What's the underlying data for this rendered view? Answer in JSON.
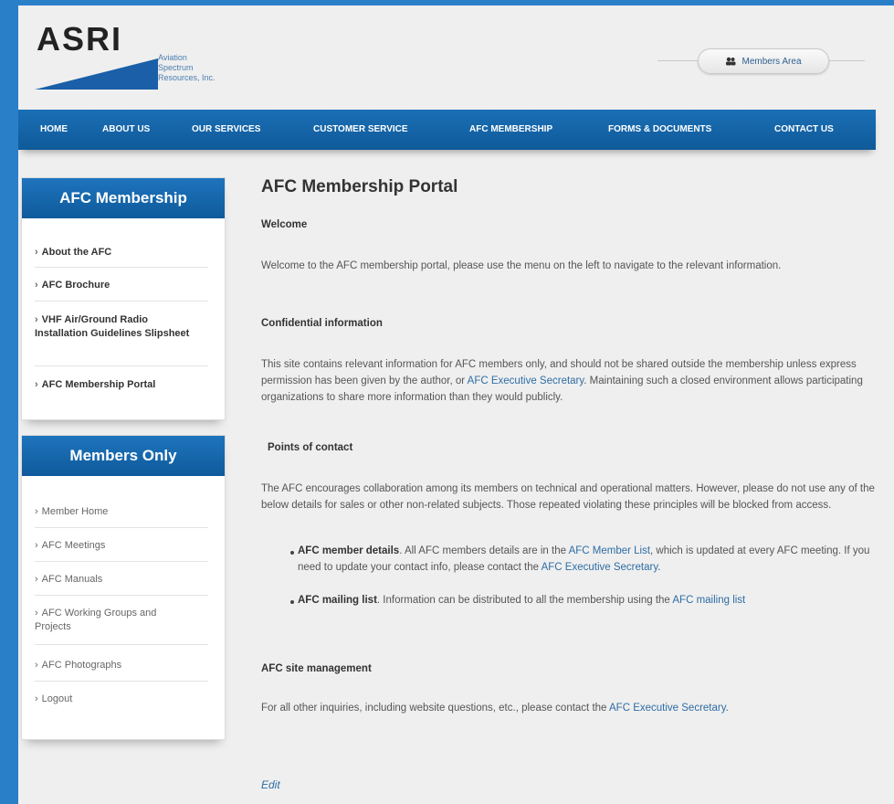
{
  "logo": {
    "name": "ASRI",
    "subtitle_lines": [
      "Aviation",
      "Spectrum",
      "Resources, Inc."
    ]
  },
  "members_area": {
    "label": "Members Area",
    "icon": "users-icon"
  },
  "nav": {
    "items": [
      "HOME",
      "ABOUT US",
      "OUR SERVICES",
      "CUSTOMER SERVICE",
      "AFC MEMBERSHIP",
      "FORMS & DOCUMENTS",
      "CONTACT US"
    ]
  },
  "sidebar": {
    "afc_title": "AFC Membership",
    "afc_items": [
      "About the AFC",
      "AFC Brochure",
      "VHF Air/Ground Radio Installation Guidelines Slipsheet",
      "AFC Membership Portal"
    ],
    "members_title": "Members Only",
    "members_items": [
      "Member Home",
      "AFC Meetings",
      "AFC Manuals",
      "AFC Working Groups and Projects",
      "AFC Photographs",
      "Logout"
    ]
  },
  "main": {
    "title": "AFC Membership Portal",
    "welcome_heading": "Welcome",
    "welcome_text": "Welcome to the AFC membership portal, please use the menu on the left to navigate to the relevant information.",
    "confidential_heading": "Confidential information",
    "confidential_text_1": "This site contains relevant information for AFC members only, and should not be shared outside the membership unless express permission has been given by the author, or ",
    "confidential_link": "AFC Executive Secretary",
    "confidential_text_2": ". Maintaining such a closed environment allows participating organizations to share more information than they would publicly.",
    "poc_heading": "Points of contact",
    "poc_text": "The AFC encourages collaboration among its members on technical and operational matters.  However, please do not use any of the below details for sales or other non-related subjects.  Those repeated violating these principles will be blocked from access.",
    "bullet1_bold": "AFC member details",
    "bullet1_text_a": ".  All AFC members details are in the ",
    "bullet1_link1": "AFC Member List",
    "bullet1_text_b": ", which is updated at every AFC meeting.  If you need to update your contact info, please contact the ",
    "bullet1_link2": "AFC Executive Secretary",
    "bullet1_text_c": ".",
    "bullet2_bold": "AFC mailing list",
    "bullet2_text": ".  Information can be distributed to all the membership using the ",
    "bullet2_link": "AFC mailing list",
    "site_heading": "AFC site management",
    "site_text": "For all other inquiries, including website questions, etc., please contact the ",
    "site_link": "AFC Executive Secretary",
    "site_text_end": ".",
    "edit": "Edit"
  },
  "colors": {
    "nav_blue": "#1465a8",
    "background_blue": "#2a7fc9",
    "link": "#2e6da4"
  }
}
